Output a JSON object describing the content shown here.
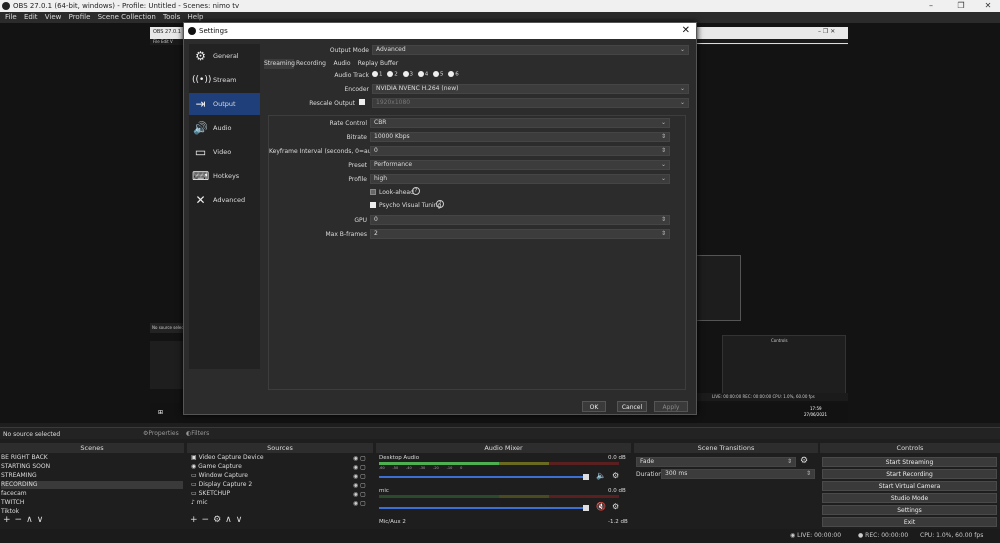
{
  "window": {
    "title": "OBS 27.0.1 (64-bit, windows) - Profile: Untitled - Scenes: nimo tv",
    "controls": [
      "–",
      "❐",
      "✕"
    ]
  },
  "menu": [
    "File",
    "Edit",
    "View",
    "Profile",
    "Scene Collection",
    "Tools",
    "Help"
  ],
  "settings": {
    "title": "Settings",
    "nav": [
      {
        "label": "General",
        "icon": "gear-icon"
      },
      {
        "label": "Stream",
        "icon": "antenna-icon"
      },
      {
        "label": "Output",
        "icon": "monitor-output-icon"
      },
      {
        "label": "Audio",
        "icon": "speaker-icon"
      },
      {
        "label": "Video",
        "icon": "display-icon"
      },
      {
        "label": "Hotkeys",
        "icon": "keyboard-icon"
      },
      {
        "label": "Advanced",
        "icon": "tools-icon"
      }
    ],
    "output_mode_label": "Output Mode",
    "output_mode_value": "Advanced",
    "tabs": [
      "Streaming",
      "Recording",
      "Audio",
      "Replay Buffer"
    ],
    "audio_track_label": "Audio Track",
    "audio_tracks": [
      "1",
      "2",
      "3",
      "4",
      "5",
      "6"
    ],
    "encoder_label": "Encoder",
    "encoder_value": "NVIDIA NVENC H.264 (new)",
    "rescale_label": "Rescale Output",
    "rescale_value": "1920x1080",
    "fields": [
      {
        "label": "Rate Control",
        "value": "CBR",
        "kind": "dropdown"
      },
      {
        "label": "Bitrate",
        "value": "10000 Kbps",
        "kind": "spin"
      },
      {
        "label": "Keyframe Interval (seconds, 0=auto)",
        "value": "0",
        "kind": "spin"
      },
      {
        "label": "Preset",
        "value": "Performance",
        "kind": "dropdown"
      },
      {
        "label": "Profile",
        "value": "high",
        "kind": "dropdown"
      }
    ],
    "lookahead_label": "Look-ahead",
    "psycho_label": "Psycho Visual Tuning",
    "gpu_label": "GPU",
    "gpu_value": "0",
    "bframes_label": "Max B-frames",
    "bframes_value": "2",
    "ok": "OK",
    "cancel": "Cancel",
    "apply": "Apply"
  },
  "source_bar": {
    "no_source": "No source selected",
    "properties": "Properties",
    "filters": "Filters"
  },
  "scenes": {
    "header": "Scenes",
    "items": [
      "BE RIGHT BACK",
      "STARTING SOON",
      "STREAMING",
      "RECORDING",
      "facecam",
      "TWITCH",
      "Tiktok"
    ]
  },
  "sources": {
    "header": "Sources",
    "items": [
      "Video Capture Device",
      "Game Capture",
      "Window Capture",
      "Display Capture 2",
      "SKETCHUP",
      "mic"
    ]
  },
  "mixer": {
    "header": "Audio Mixer",
    "channels": [
      {
        "name": "Desktop Audio",
        "db": "0.0 dB"
      },
      {
        "name": "mic",
        "db": "0.0 dB"
      },
      {
        "name": "Mic/Aux 2",
        "db": "-1.2 dB"
      }
    ],
    "scale": [
      "-60",
      "-55",
      "-50",
      "-45",
      "-40",
      "-35",
      "-30",
      "-25",
      "-20",
      "-15",
      "-10",
      "-5",
      "0"
    ]
  },
  "transitions": {
    "header": "Scene Transitions",
    "type": "Fade",
    "duration_label": "Duration",
    "duration_value": "300 ms"
  },
  "controls": {
    "header": "Controls",
    "buttons": [
      "Start Streaming",
      "Start Recording",
      "Start Virtual Camera",
      "Studio Mode",
      "Settings",
      "Exit"
    ]
  },
  "status": {
    "live": "LIVE: 00:00:00",
    "rec": "REC: 00:00:00",
    "cpu": "CPU: 1.0%, 60.00 fps"
  },
  "nested_preview": {
    "title": "OBS 27.0.1",
    "menu": "File  Edit  V",
    "no_source": "No source select",
    "clock_time": "17:59",
    "clock_date": "27/06/2021",
    "mini_controls_header": "Controls",
    "mini_status": "LIVE: 00:00:00   REC: 00:00:00   CPU: 1.0%, 60.00 fps"
  },
  "colors": {
    "accent": "#1e3f7a",
    "meter_green": "#4caf50",
    "meter_yellow": "#c8c800",
    "meter_red": "#d03030",
    "mute_red": "#e04040"
  }
}
